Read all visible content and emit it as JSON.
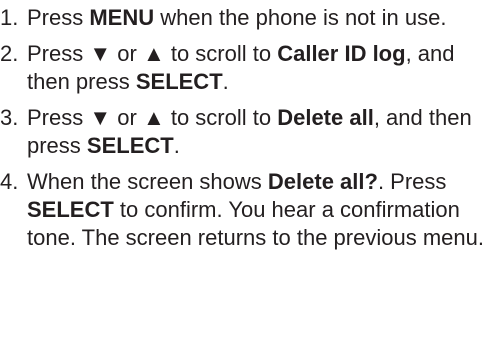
{
  "instructions": {
    "steps": [
      {
        "number": "1.",
        "parts": [
          "Press ",
          "MENU",
          " when the phone is not in use."
        ]
      },
      {
        "number": "2.",
        "parts": [
          "Press ",
          "▼",
          " or ",
          "▲",
          " to scroll to ",
          "Caller ID log",
          ", and then press ",
          "SELECT",
          "."
        ]
      },
      {
        "number": "3.",
        "parts": [
          "Press ",
          "▼",
          " or ",
          "▲",
          " to scroll to ",
          "Delete all",
          ", and then press ",
          "SELECT",
          "."
        ]
      },
      {
        "number": "4.",
        "parts": [
          "When the screen shows ",
          "Delete all?",
          ". Press ",
          "SELECT",
          " to confirm. You hear a confirmation tone. The screen returns to the previous menu."
        ]
      }
    ]
  }
}
